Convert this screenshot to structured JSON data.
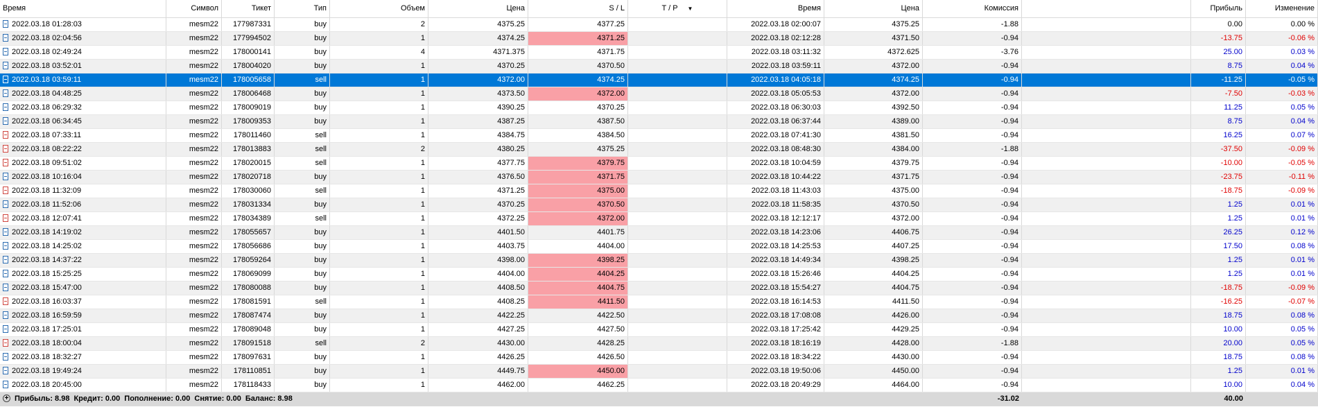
{
  "columns": [
    "Время",
    "Символ",
    "Тикет",
    "Тип",
    "Объем",
    "Цена",
    "S / L",
    "T / P",
    "Время",
    "Цена",
    "Комиссия",
    "",
    "Прибыль",
    "Изменение"
  ],
  "sort_indicator": "▼",
  "rows": [
    {
      "open_time": "2022.03.18 01:28:03",
      "symbol": "mesm22",
      "ticket": "177987331",
      "type": "buy",
      "volume": "2",
      "price": "4375.25",
      "sl": "4377.25",
      "tp": "",
      "close_time": "2022.03.18 02:00:07",
      "close_price": "4375.25",
      "commission": "-1.88",
      "profit": "0.00",
      "change": "0.00 %",
      "sl_hit": false,
      "sign": "zero"
    },
    {
      "open_time": "2022.03.18 02:04:56",
      "symbol": "mesm22",
      "ticket": "177994502",
      "type": "buy",
      "volume": "1",
      "price": "4374.25",
      "sl": "4371.25",
      "tp": "",
      "close_time": "2022.03.18 02:12:28",
      "close_price": "4371.50",
      "commission": "-0.94",
      "profit": "-13.75",
      "change": "-0.06 %",
      "sl_hit": true,
      "sign": "neg"
    },
    {
      "open_time": "2022.03.18 02:49:24",
      "symbol": "mesm22",
      "ticket": "178000141",
      "type": "buy",
      "volume": "4",
      "price": "4371.375",
      "sl": "4371.75",
      "tp": "",
      "close_time": "2022.03.18 03:11:32",
      "close_price": "4372.625",
      "commission": "-3.76",
      "profit": "25.00",
      "change": "0.03 %",
      "sl_hit": false,
      "sign": "pos"
    },
    {
      "open_time": "2022.03.18 03:52:01",
      "symbol": "mesm22",
      "ticket": "178004020",
      "type": "buy",
      "volume": "1",
      "price": "4370.25",
      "sl": "4370.50",
      "tp": "",
      "close_time": "2022.03.18 03:59:11",
      "close_price": "4372.00",
      "commission": "-0.94",
      "profit": "8.75",
      "change": "0.04 %",
      "sl_hit": false,
      "sign": "pos"
    },
    {
      "open_time": "2022.03.18 03:59:11",
      "symbol": "mesm22",
      "ticket": "178005658",
      "type": "sell",
      "volume": "1",
      "price": "4372.00",
      "sl": "4374.25",
      "tp": "",
      "close_time": "2022.03.18 04:05:18",
      "close_price": "4374.25",
      "commission": "-0.94",
      "profit": "-11.25",
      "change": "-0.05 %",
      "sl_hit": true,
      "sign": "neg",
      "selected": true
    },
    {
      "open_time": "2022.03.18 04:48:25",
      "symbol": "mesm22",
      "ticket": "178006468",
      "type": "buy",
      "volume": "1",
      "price": "4373.50",
      "sl": "4372.00",
      "tp": "",
      "close_time": "2022.03.18 05:05:53",
      "close_price": "4372.00",
      "commission": "-0.94",
      "profit": "-7.50",
      "change": "-0.03 %",
      "sl_hit": true,
      "sign": "neg"
    },
    {
      "open_time": "2022.03.18 06:29:32",
      "symbol": "mesm22",
      "ticket": "178009019",
      "type": "buy",
      "volume": "1",
      "price": "4390.25",
      "sl": "4370.25",
      "tp": "",
      "close_time": "2022.03.18 06:30:03",
      "close_price": "4392.50",
      "commission": "-0.94",
      "profit": "11.25",
      "change": "0.05 %",
      "sl_hit": false,
      "sign": "pos"
    },
    {
      "open_time": "2022.03.18 06:34:45",
      "symbol": "mesm22",
      "ticket": "178009353",
      "type": "buy",
      "volume": "1",
      "price": "4387.25",
      "sl": "4387.50",
      "tp": "",
      "close_time": "2022.03.18 06:37:44",
      "close_price": "4389.00",
      "commission": "-0.94",
      "profit": "8.75",
      "change": "0.04 %",
      "sl_hit": false,
      "sign": "pos"
    },
    {
      "open_time": "2022.03.18 07:33:11",
      "symbol": "mesm22",
      "ticket": "178011460",
      "type": "sell",
      "volume": "1",
      "price": "4384.75",
      "sl": "4384.50",
      "tp": "",
      "close_time": "2022.03.18 07:41:30",
      "close_price": "4381.50",
      "commission": "-0.94",
      "profit": "16.25",
      "change": "0.07 %",
      "sl_hit": false,
      "sign": "pos"
    },
    {
      "open_time": "2022.03.18 08:22:22",
      "symbol": "mesm22",
      "ticket": "178013883",
      "type": "sell",
      "volume": "2",
      "price": "4380.25",
      "sl": "4375.25",
      "tp": "",
      "close_time": "2022.03.18 08:48:30",
      "close_price": "4384.00",
      "commission": "-1.88",
      "profit": "-37.50",
      "change": "-0.09 %",
      "sl_hit": false,
      "sign": "neg"
    },
    {
      "open_time": "2022.03.18 09:51:02",
      "symbol": "mesm22",
      "ticket": "178020015",
      "type": "sell",
      "volume": "1",
      "price": "4377.75",
      "sl": "4379.75",
      "tp": "",
      "close_time": "2022.03.18 10:04:59",
      "close_price": "4379.75",
      "commission": "-0.94",
      "profit": "-10.00",
      "change": "-0.05 %",
      "sl_hit": true,
      "sign": "neg"
    },
    {
      "open_time": "2022.03.18 10:16:04",
      "symbol": "mesm22",
      "ticket": "178020718",
      "type": "buy",
      "volume": "1",
      "price": "4376.50",
      "sl": "4371.75",
      "tp": "",
      "close_time": "2022.03.18 10:44:22",
      "close_price": "4371.75",
      "commission": "-0.94",
      "profit": "-23.75",
      "change": "-0.11 %",
      "sl_hit": true,
      "sign": "neg"
    },
    {
      "open_time": "2022.03.18 11:32:09",
      "symbol": "mesm22",
      "ticket": "178030060",
      "type": "sell",
      "volume": "1",
      "price": "4371.25",
      "sl": "4375.00",
      "tp": "",
      "close_time": "2022.03.18 11:43:03",
      "close_price": "4375.00",
      "commission": "-0.94",
      "profit": "-18.75",
      "change": "-0.09 %",
      "sl_hit": true,
      "sign": "neg"
    },
    {
      "open_time": "2022.03.18 11:52:06",
      "symbol": "mesm22",
      "ticket": "178031334",
      "type": "buy",
      "volume": "1",
      "price": "4370.25",
      "sl": "4370.50",
      "tp": "",
      "close_time": "2022.03.18 11:58:35",
      "close_price": "4370.50",
      "commission": "-0.94",
      "profit": "1.25",
      "change": "0.01 %",
      "sl_hit": true,
      "sign": "pos"
    },
    {
      "open_time": "2022.03.18 12:07:41",
      "symbol": "mesm22",
      "ticket": "178034389",
      "type": "sell",
      "volume": "1",
      "price": "4372.25",
      "sl": "4372.00",
      "tp": "",
      "close_time": "2022.03.18 12:12:17",
      "close_price": "4372.00",
      "commission": "-0.94",
      "profit": "1.25",
      "change": "0.01 %",
      "sl_hit": true,
      "sign": "pos"
    },
    {
      "open_time": "2022.03.18 14:19:02",
      "symbol": "mesm22",
      "ticket": "178055657",
      "type": "buy",
      "volume": "1",
      "price": "4401.50",
      "sl": "4401.75",
      "tp": "",
      "close_time": "2022.03.18 14:23:06",
      "close_price": "4406.75",
      "commission": "-0.94",
      "profit": "26.25",
      "change": "0.12 %",
      "sl_hit": false,
      "sign": "pos"
    },
    {
      "open_time": "2022.03.18 14:25:02",
      "symbol": "mesm22",
      "ticket": "178056686",
      "type": "buy",
      "volume": "1",
      "price": "4403.75",
      "sl": "4404.00",
      "tp": "",
      "close_time": "2022.03.18 14:25:53",
      "close_price": "4407.25",
      "commission": "-0.94",
      "profit": "17.50",
      "change": "0.08 %",
      "sl_hit": false,
      "sign": "pos"
    },
    {
      "open_time": "2022.03.18 14:37:22",
      "symbol": "mesm22",
      "ticket": "178059264",
      "type": "buy",
      "volume": "1",
      "price": "4398.00",
      "sl": "4398.25",
      "tp": "",
      "close_time": "2022.03.18 14:49:34",
      "close_price": "4398.25",
      "commission": "-0.94",
      "profit": "1.25",
      "change": "0.01 %",
      "sl_hit": true,
      "sign": "pos"
    },
    {
      "open_time": "2022.03.18 15:25:25",
      "symbol": "mesm22",
      "ticket": "178069099",
      "type": "buy",
      "volume": "1",
      "price": "4404.00",
      "sl": "4404.25",
      "tp": "",
      "close_time": "2022.03.18 15:26:46",
      "close_price": "4404.25",
      "commission": "-0.94",
      "profit": "1.25",
      "change": "0.01 %",
      "sl_hit": true,
      "sign": "pos"
    },
    {
      "open_time": "2022.03.18 15:47:00",
      "symbol": "mesm22",
      "ticket": "178080088",
      "type": "buy",
      "volume": "1",
      "price": "4408.50",
      "sl": "4404.75",
      "tp": "",
      "close_time": "2022.03.18 15:54:27",
      "close_price": "4404.75",
      "commission": "-0.94",
      "profit": "-18.75",
      "change": "-0.09 %",
      "sl_hit": true,
      "sign": "neg"
    },
    {
      "open_time": "2022.03.18 16:03:37",
      "symbol": "mesm22",
      "ticket": "178081591",
      "type": "sell",
      "volume": "1",
      "price": "4408.25",
      "sl": "4411.50",
      "tp": "",
      "close_time": "2022.03.18 16:14:53",
      "close_price": "4411.50",
      "commission": "-0.94",
      "profit": "-16.25",
      "change": "-0.07 %",
      "sl_hit": true,
      "sign": "neg"
    },
    {
      "open_time": "2022.03.18 16:59:59",
      "symbol": "mesm22",
      "ticket": "178087474",
      "type": "buy",
      "volume": "1",
      "price": "4422.25",
      "sl": "4422.50",
      "tp": "",
      "close_time": "2022.03.18 17:08:08",
      "close_price": "4426.00",
      "commission": "-0.94",
      "profit": "18.75",
      "change": "0.08 %",
      "sl_hit": false,
      "sign": "pos"
    },
    {
      "open_time": "2022.03.18 17:25:01",
      "symbol": "mesm22",
      "ticket": "178089048",
      "type": "buy",
      "volume": "1",
      "price": "4427.25",
      "sl": "4427.50",
      "tp": "",
      "close_time": "2022.03.18 17:25:42",
      "close_price": "4429.25",
      "commission": "-0.94",
      "profit": "10.00",
      "change": "0.05 %",
      "sl_hit": false,
      "sign": "pos"
    },
    {
      "open_time": "2022.03.18 18:00:04",
      "symbol": "mesm22",
      "ticket": "178091518",
      "type": "sell",
      "volume": "2",
      "price": "4430.00",
      "sl": "4428.25",
      "tp": "",
      "close_time": "2022.03.18 18:16:19",
      "close_price": "4428.00",
      "commission": "-1.88",
      "profit": "20.00",
      "change": "0.05 %",
      "sl_hit": false,
      "sign": "pos"
    },
    {
      "open_time": "2022.03.18 18:32:27",
      "symbol": "mesm22",
      "ticket": "178097631",
      "type": "buy",
      "volume": "1",
      "price": "4426.25",
      "sl": "4426.50",
      "tp": "",
      "close_time": "2022.03.18 18:34:22",
      "close_price": "4430.00",
      "commission": "-0.94",
      "profit": "18.75",
      "change": "0.08 %",
      "sl_hit": false,
      "sign": "pos"
    },
    {
      "open_time": "2022.03.18 19:49:24",
      "symbol": "mesm22",
      "ticket": "178110851",
      "type": "buy",
      "volume": "1",
      "price": "4449.75",
      "sl": "4450.00",
      "tp": "",
      "close_time": "2022.03.18 19:50:06",
      "close_price": "4450.00",
      "commission": "-0.94",
      "profit": "1.25",
      "change": "0.01 %",
      "sl_hit": true,
      "sign": "pos"
    },
    {
      "open_time": "2022.03.18 20:45:00",
      "symbol": "mesm22",
      "ticket": "178118433",
      "type": "buy",
      "volume": "1",
      "price": "4462.00",
      "sl": "4462.25",
      "tp": "",
      "close_time": "2022.03.18 20:49:29",
      "close_price": "4464.00",
      "commission": "-0.94",
      "profit": "10.00",
      "change": "0.04 %",
      "sl_hit": false,
      "sign": "pos"
    }
  ],
  "summary": {
    "profit": "Прибыль: 8.98",
    "credit": "Кредит: 0.00",
    "deposit": "Пополнение: 0.00",
    "withdrawal": "Снятие: 0.00",
    "balance": "Баланс: 8.98",
    "total_commission": "-31.02",
    "total_profit": "40.00"
  },
  "colors": {
    "selection": "#0078d7",
    "sl_highlight": "#f9a0a6",
    "negative": "#e00000",
    "positive": "#0000cc",
    "alt_row": "#f0f0f0",
    "footer": "#d9d9d9"
  }
}
